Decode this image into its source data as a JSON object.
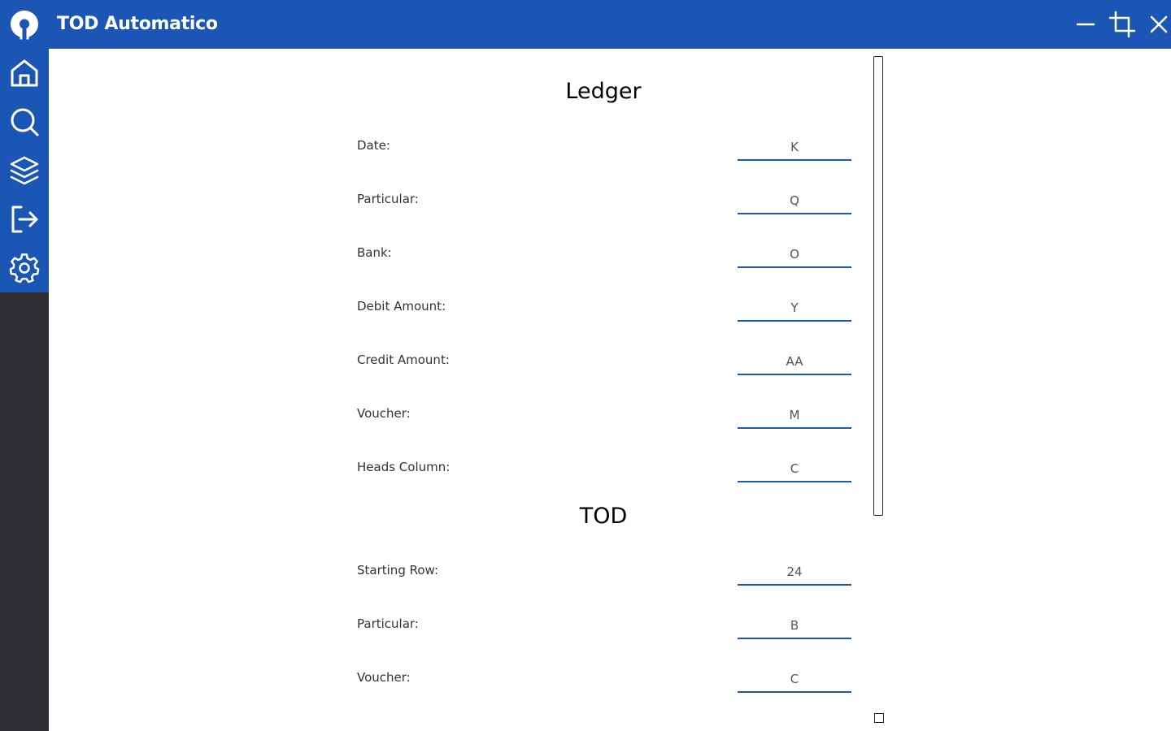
{
  "app": {
    "title": "TOD Automatico",
    "accent_color": "#1b56b5",
    "sidebar_dark_color": "#2b2d31"
  },
  "window_controls": [
    {
      "name": "minimize",
      "icon": "minimize-icon"
    },
    {
      "name": "maximize",
      "icon": "crop-icon"
    },
    {
      "name": "close",
      "icon": "close-icon"
    }
  ],
  "sidebar": {
    "items": [
      {
        "name": "home",
        "icon": "home-icon"
      },
      {
        "name": "search",
        "icon": "search-icon"
      },
      {
        "name": "layers",
        "icon": "layers-icon"
      },
      {
        "name": "logout",
        "icon": "logout-icon"
      },
      {
        "name": "settings",
        "icon": "gear-icon"
      }
    ]
  },
  "ledger": {
    "title": "Ledger",
    "fields": [
      {
        "label": "Date:",
        "value": "K"
      },
      {
        "label": "Particular:",
        "value": "Q"
      },
      {
        "label": "Bank:",
        "value": "O"
      },
      {
        "label": "Debit Amount:",
        "value": "Y"
      },
      {
        "label": "Credit Amount:",
        "value": "AA"
      },
      {
        "label": "Voucher:",
        "value": "M"
      },
      {
        "label": "Heads Column:",
        "value": "C"
      }
    ]
  },
  "tod": {
    "title": "TOD",
    "fields": [
      {
        "label": "Starting Row:",
        "value": "24"
      },
      {
        "label": "Particular:",
        "value": "B"
      },
      {
        "label": "Voucher:",
        "value": "C"
      }
    ]
  }
}
